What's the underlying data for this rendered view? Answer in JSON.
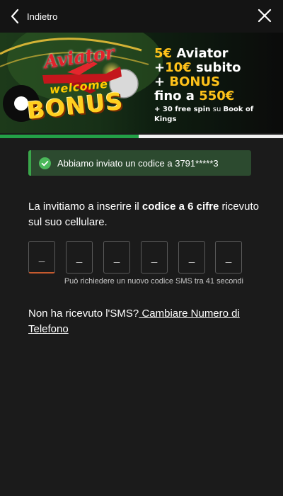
{
  "header": {
    "back_label": "Indietro",
    "back_icon": "chevron-left-icon",
    "close_icon": "close-icon"
  },
  "banner": {
    "brand": "Aviator",
    "welcome": "welcome",
    "bonus": "BONUS",
    "promo_line_1_a": "5€",
    "promo_line_1_b": " Aviator",
    "promo_line_2_a": "+",
    "promo_line_2_b": "10€",
    "promo_line_2_c": " subito",
    "promo_line_3_a": "+",
    "promo_line_3_b": " BONUS",
    "promo_line_4_a": "fino a ",
    "promo_line_4_b": "550€",
    "promo_small_a": "+ 30 free spin ",
    "promo_small_b": "su ",
    "promo_small_c": "Book of Kings",
    "info_icon": "info-icon"
  },
  "progress": {
    "fraction": 0.49,
    "fill_color": "#23a047",
    "track_color": "#f0f0f0"
  },
  "notice": {
    "icon": "check-circle-icon",
    "text": "Abbiamo inviato un codice a 3791*****3",
    "accent_color": "#3aa64a"
  },
  "instruction": {
    "text_before": "La invitiamo a inserire il ",
    "text_bold": "codice a 6 cifre",
    "text_after": " ricevuto sul suo cellulare."
  },
  "code": {
    "digit_count": 6,
    "placeholder": "_",
    "values": [
      "",
      "",
      "",
      "",
      "",
      ""
    ]
  },
  "resend": {
    "text": "Può richiedere un nuovo codice SMS tra 41 secondi"
  },
  "help": {
    "text": "Non ha ricevuto l'SMS?",
    "link": " Cambiare Numero di Telefono"
  }
}
